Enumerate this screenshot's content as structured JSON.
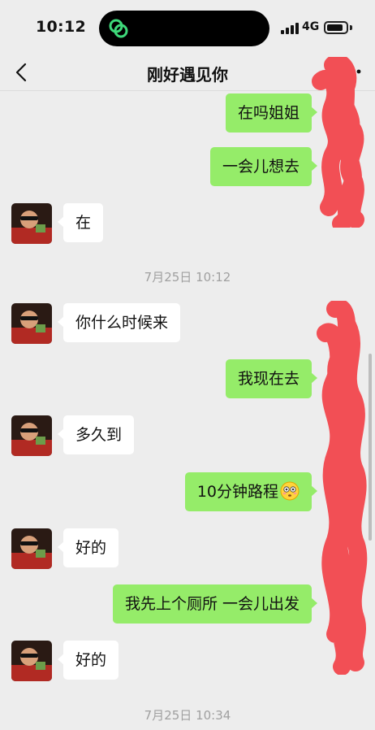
{
  "status_bar": {
    "time": "10:12",
    "network": "4G",
    "icons": [
      "app-link-icon",
      "signal-icon",
      "battery-icon"
    ]
  },
  "nav": {
    "title": "刚好遇见你",
    "icons": [
      "back-icon",
      "more-icon"
    ]
  },
  "chat": {
    "messages": [
      {
        "side": "out",
        "text": "在吗姐姐"
      },
      {
        "side": "out",
        "text": "一会儿想去"
      },
      {
        "side": "in",
        "text": "在"
      },
      {
        "type": "time",
        "text": "7月25日 10:12"
      },
      {
        "side": "in",
        "text": "你什么时候来"
      },
      {
        "side": "out",
        "text": "我现在去"
      },
      {
        "side": "in",
        "text": "多久到"
      },
      {
        "side": "out",
        "text": "10分钟路程",
        "emoji": "flushed-face-icon"
      },
      {
        "side": "in",
        "text": "好的"
      },
      {
        "side": "out",
        "text": "我先上个厕所 一会儿出发"
      },
      {
        "side": "in",
        "text": "好的"
      },
      {
        "type": "time",
        "text": "7月25日 10:34"
      }
    ]
  },
  "colors": {
    "background": "#ededed",
    "outgoing_bubble": "#95ec69",
    "incoming_bubble": "#ffffff",
    "redaction": "#f24f55"
  }
}
